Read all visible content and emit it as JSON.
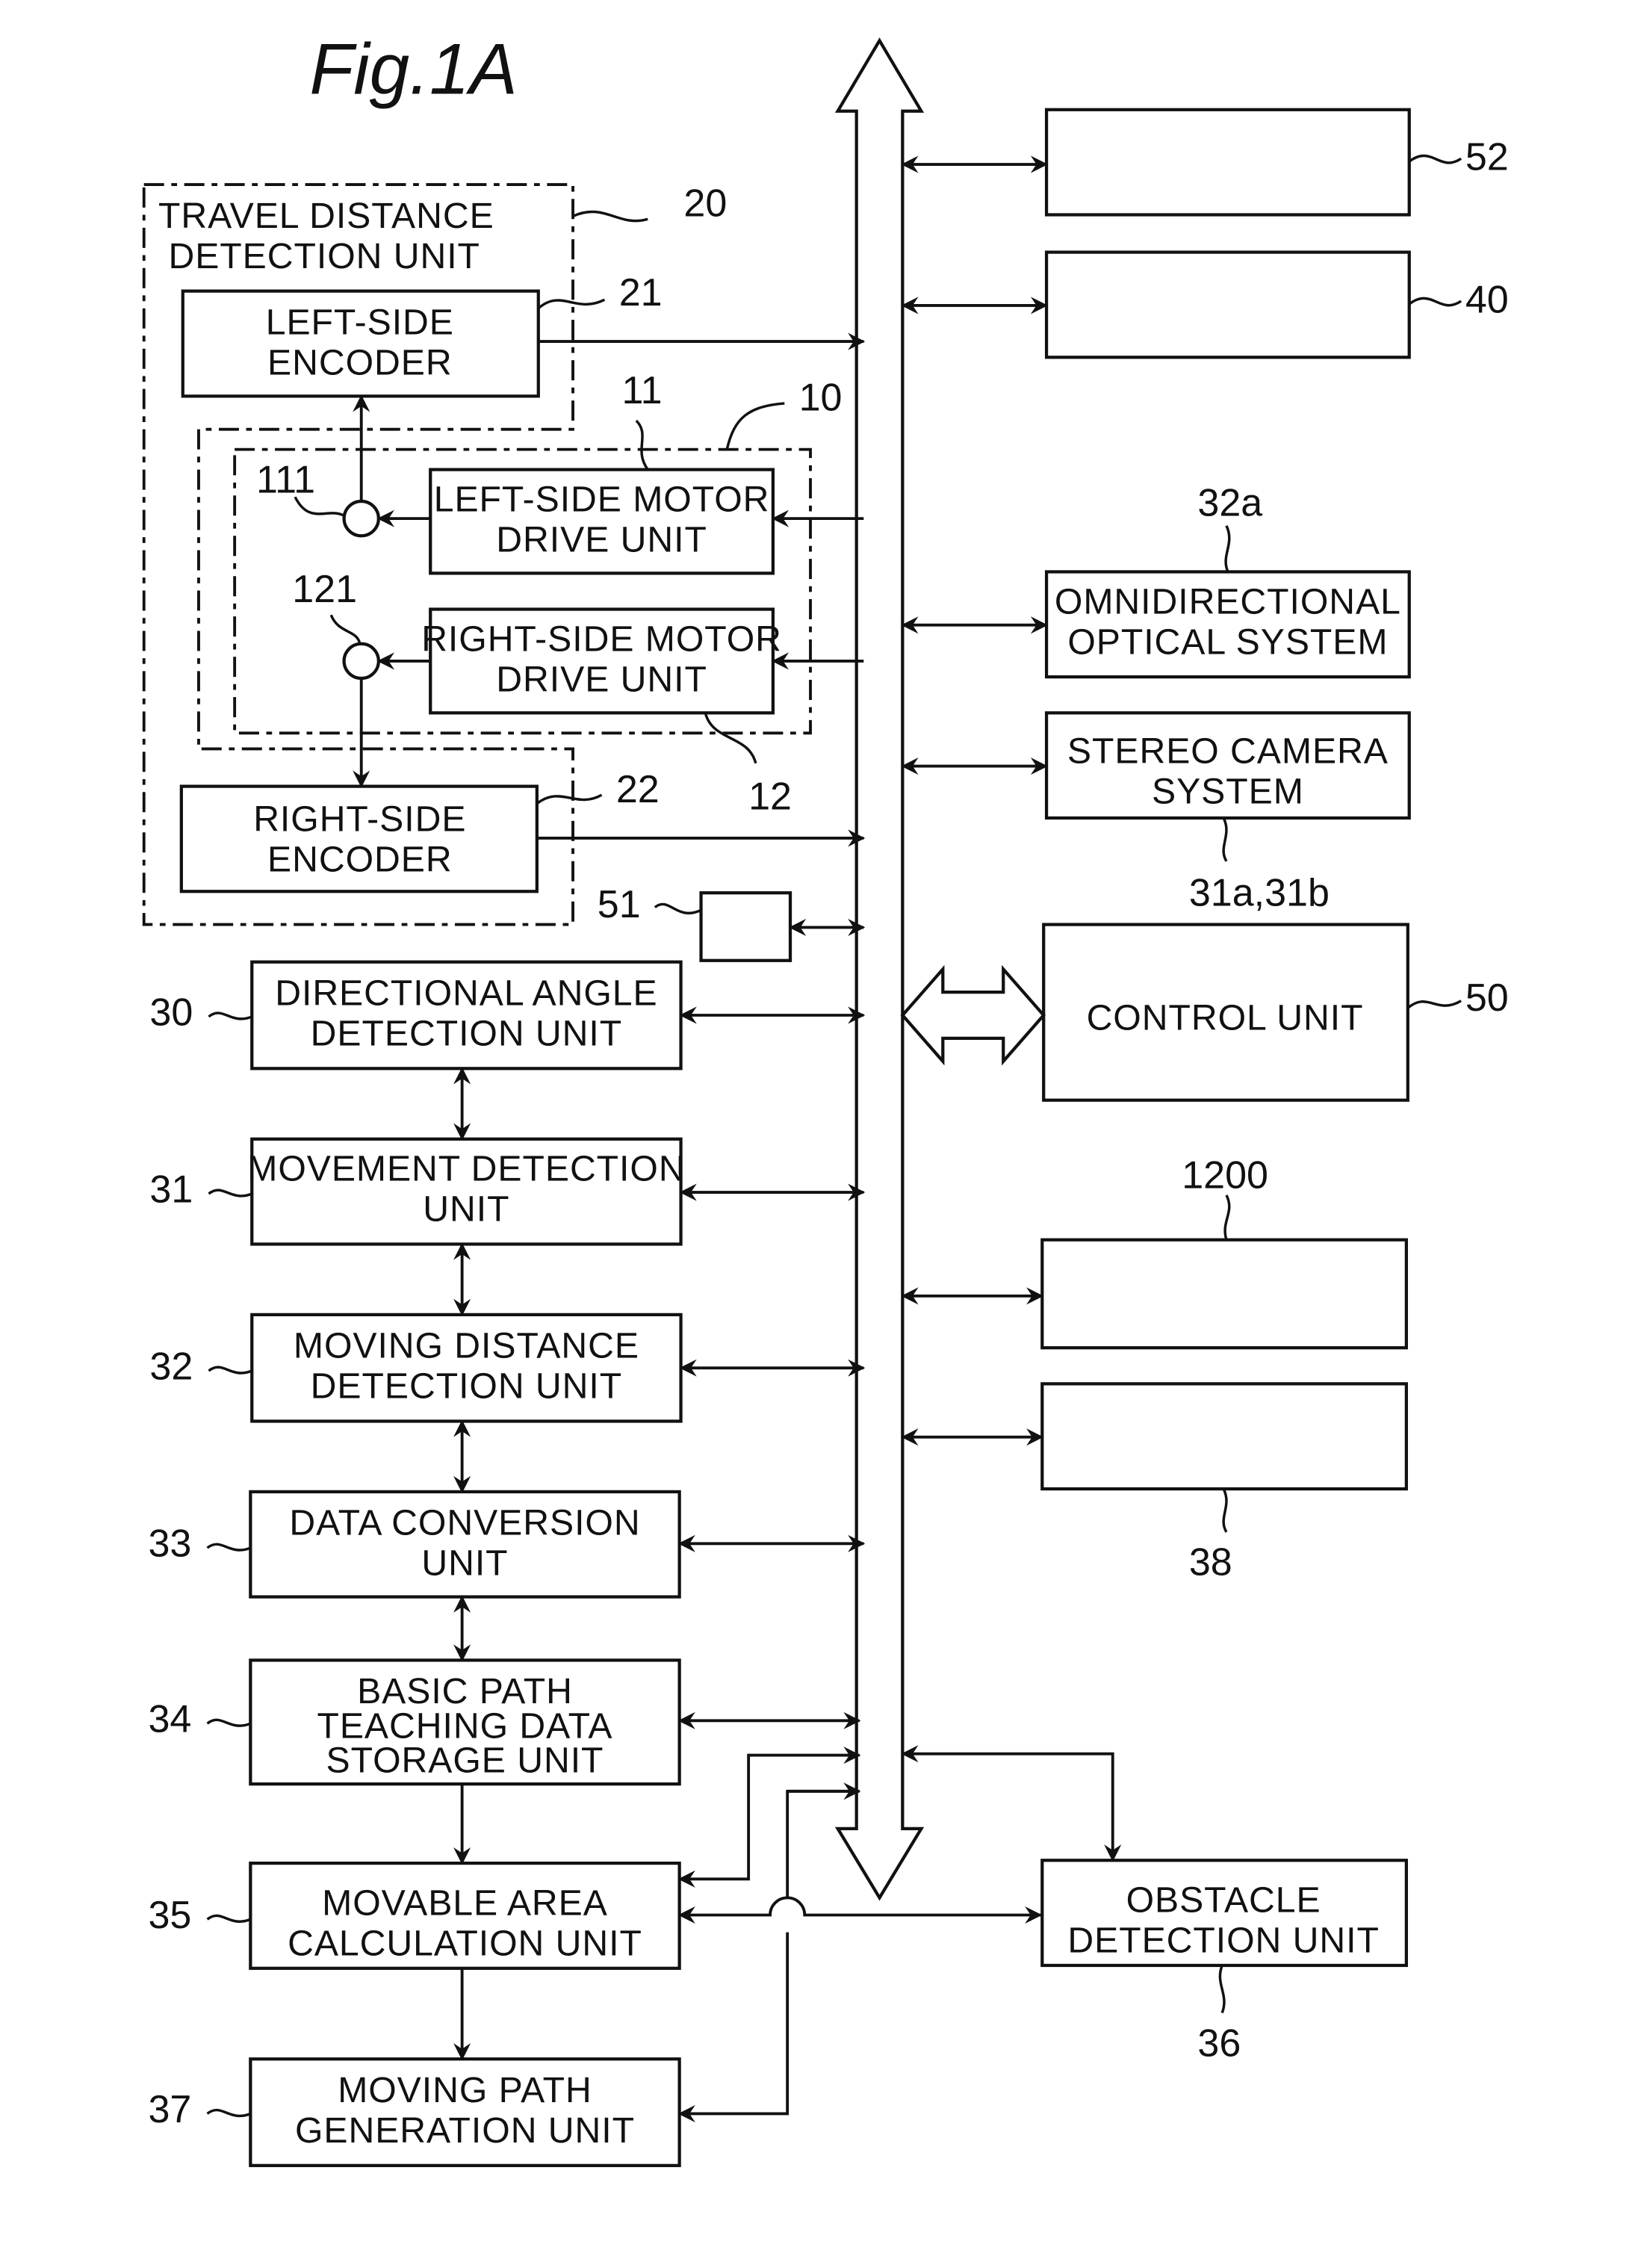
{
  "figure": {
    "title": "Fig.1A"
  },
  "units": {
    "travel_distance": {
      "label": [
        "TRAVEL DISTANCE",
        "DETECTION UNIT"
      ],
      "ref": "20"
    },
    "left_encoder": {
      "label": [
        "LEFT-SIDE",
        "ENCODER"
      ],
      "ref": "21"
    },
    "right_encoder": {
      "label": [
        "RIGHT-SIDE",
        "ENCODER"
      ],
      "ref": "22"
    },
    "drive_group": {
      "ref": "10"
    },
    "left_motor": {
      "label": [
        "LEFT-SIDE MOTOR",
        "DRIVE UNIT"
      ],
      "ref": "11"
    },
    "right_motor": {
      "label": [
        "RIGHT-SIDE MOTOR",
        "DRIVE UNIT"
      ],
      "ref": "12"
    },
    "left_wheel": {
      "ref": "111"
    },
    "right_wheel": {
      "ref": "121"
    },
    "small_box": {
      "ref": "51"
    },
    "directional_angle": {
      "label": [
        "DIRECTIONAL ANGLE",
        "DETECTION UNIT"
      ],
      "ref": "30"
    },
    "movement_detection": {
      "label": [
        "MOVEMENT DETECTION",
        "UNIT"
      ],
      "ref": "31"
    },
    "moving_distance": {
      "label": [
        "MOVING DISTANCE",
        "DETECTION UNIT"
      ],
      "ref": "32"
    },
    "data_conversion": {
      "label": [
        "DATA CONVERSION",
        "UNIT"
      ],
      "ref": "33"
    },
    "basic_path": {
      "label": [
        "BASIC PATH",
        "TEACHING DATA",
        "STORAGE UNIT"
      ],
      "ref": "34"
    },
    "movable_area": {
      "label": [
        "MOVABLE AREA",
        "CALCULATION UNIT"
      ],
      "ref": "35"
    },
    "moving_path": {
      "label": [
        "MOVING PATH",
        "GENERATION UNIT"
      ],
      "ref": "37"
    },
    "box_52": {
      "ref": "52"
    },
    "box_40": {
      "ref": "40"
    },
    "omni_optical": {
      "label": [
        "OMNIDIRECTIONAL",
        "OPTICAL SYSTEM"
      ],
      "ref": "32a"
    },
    "stereo_camera": {
      "label": [
        "STEREO CAMERA",
        "SYSTEM"
      ],
      "ref": "31a,31b"
    },
    "control_unit": {
      "label": [
        "CONTROL UNIT"
      ],
      "ref": "50"
    },
    "box_1200": {
      "ref": "1200"
    },
    "box_38": {
      "ref": "38"
    },
    "obstacle_detection": {
      "label": [
        "OBSTACLE",
        "DETECTION UNIT"
      ],
      "ref": "36"
    }
  }
}
